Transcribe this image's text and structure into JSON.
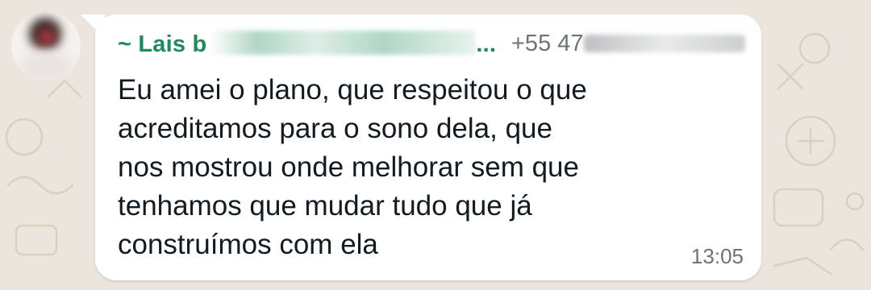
{
  "colors": {
    "wallpaper": "#ece5dd",
    "bubble": "#ffffff",
    "sender_name": "#1f8a5a",
    "meta_text": "#6d7377",
    "message_text": "#111b21"
  },
  "message": {
    "sender_name": "~ Lais b",
    "sender_name_suffix": "...",
    "sender_phone": "+55 47",
    "lines": [
      "Eu amei o plano, que respeitou o que",
      "acreditamos para o sono dela, que",
      "nos mostrou onde melhorar sem que",
      "tenhamos que mudar tudo que já",
      "construímos com ela"
    ],
    "time": "13:05"
  }
}
